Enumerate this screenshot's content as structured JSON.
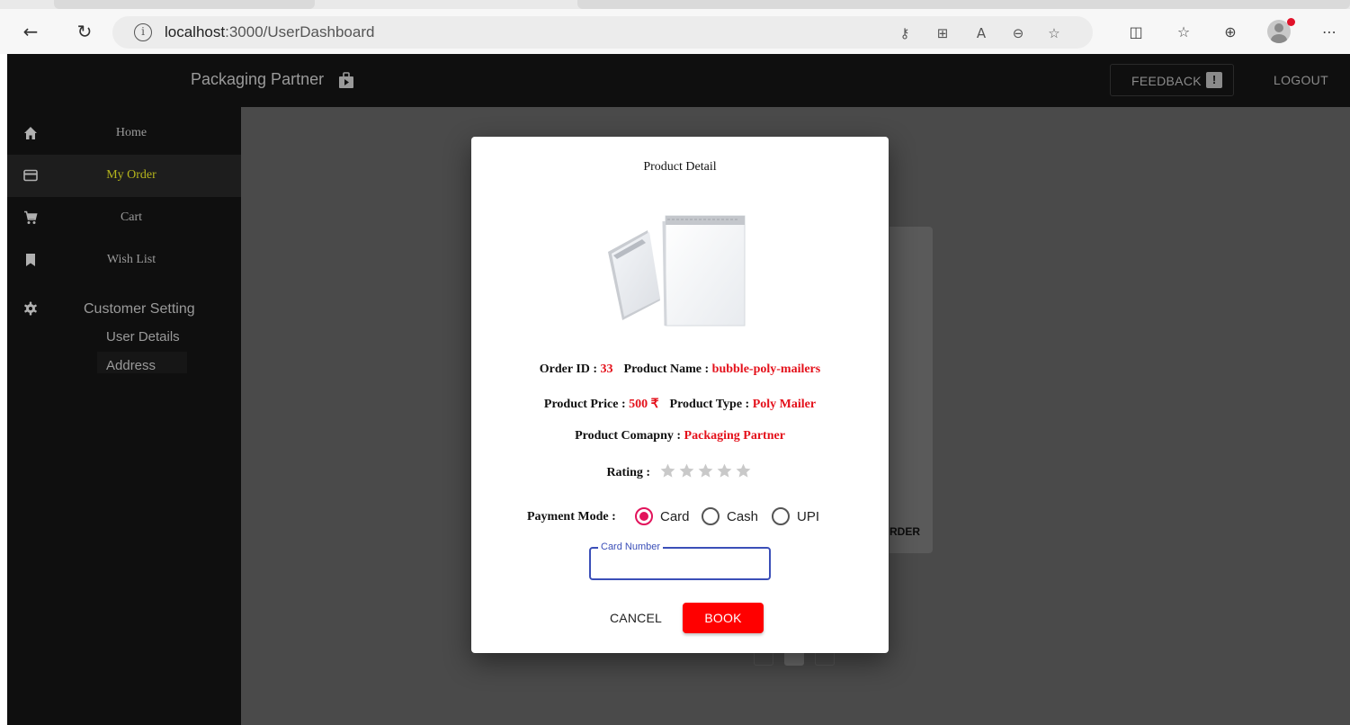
{
  "browser": {
    "url_host": "localhost",
    "url_path": ":3000/UserDashboard"
  },
  "appbar": {
    "brand": "Packaging Partner",
    "feedback_label": "FEEDBACK",
    "logout_label": "LOGOUT"
  },
  "sidebar": {
    "items": [
      {
        "label": "Home",
        "icon": "home-icon"
      },
      {
        "label": "My Order",
        "icon": "card-icon",
        "active": true
      },
      {
        "label": "Cart",
        "icon": "cart-icon"
      },
      {
        "label": "Wish List",
        "icon": "bookmark-icon"
      }
    ],
    "settings": {
      "label": "Customer Setting",
      "icon": "gear-icon",
      "sub_items": [
        "User Details",
        "Address"
      ]
    }
  },
  "background": {
    "order_button_text": "RDER"
  },
  "modal": {
    "title": "Product Detail",
    "order_id_label": "Order ID : ",
    "order_id": "33",
    "product_name_label": "Product Name : ",
    "product_name": "bubble-poly-mailers",
    "price_label": "Product Price : ",
    "price": "500 ₹",
    "type_label": "Product Type : ",
    "type": "Poly Mailer",
    "company_label": "Product Comapny : ",
    "company": "Packaging Partner",
    "rating_label": "Rating : ",
    "rating": 0,
    "rating_max": 5,
    "payment_label": "Payment Mode :",
    "payment_options": [
      "Card",
      "Cash",
      "UPI"
    ],
    "payment_selected": "Card",
    "card_number_label": "Card Number",
    "card_number_value": "",
    "cancel_label": "CANCEL",
    "book_label": "BOOK"
  },
  "colors": {
    "value_red": "#e4111b",
    "active_menu": "#b5b51c",
    "radio_selected": "#e2135b",
    "field_focus": "#3b4fb8",
    "book_button": "#ff0000"
  }
}
